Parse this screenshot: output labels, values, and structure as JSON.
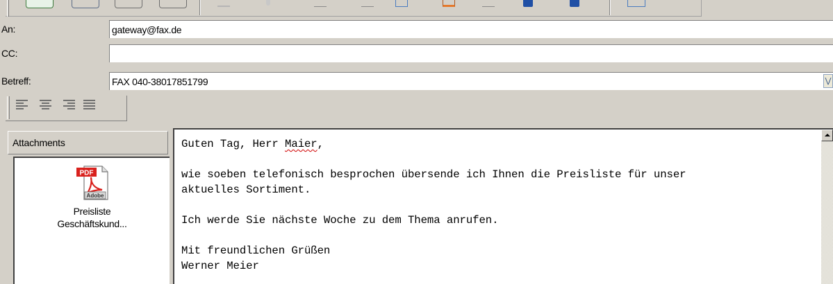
{
  "header": {
    "to_label": "An:",
    "to_value": "gateway@fax.de",
    "cc_label": "CC:",
    "cc_value": "",
    "subject_label": "Betreff:",
    "subject_value": "FAX 040-38017851799"
  },
  "formatting": {
    "align_buttons": [
      "align-left-icon",
      "align-center-icon",
      "align-right-icon",
      "align-justify-icon"
    ]
  },
  "attachments": {
    "header_label": "Attachments",
    "items": [
      {
        "icon": "pdf-file-icon",
        "badge": "PDF",
        "brand": "Adobe",
        "name_line1": "Preisliste",
        "name_line2": "Geschäftskund..."
      }
    ]
  },
  "message": {
    "line1_prefix": "Guten Tag, Herr ",
    "line1_misspelled": "Maier",
    "line1_suffix": ",",
    "paragraph1": "wie soeben telefonisch besprochen übersende ich Ihnen die Preisliste für unser\naktuelles Sortiment.",
    "paragraph2": "Ich werde Sie nächste Woche zu dem Thema anrufen.",
    "closing": "Mit freundlichen Grüßen",
    "signature": "Werner Meier"
  },
  "colors": {
    "window_bg": "#d4d0c8",
    "spellcheck_underline": "#d00000",
    "pdf_red": "#d9211d"
  }
}
